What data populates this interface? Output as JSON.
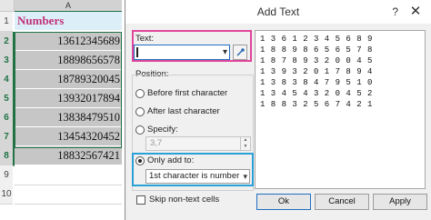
{
  "sheet": {
    "column": "A",
    "rows": [
      "1",
      "2",
      "3",
      "4",
      "5",
      "6",
      "7",
      "8",
      "9",
      "10"
    ],
    "header_cell": "Numbers",
    "values": [
      "13612345689",
      "18898656578",
      "18789320045",
      "13932017894",
      "13838479510",
      "13454320452",
      "18832567421"
    ]
  },
  "dialog": {
    "title": "Add Text",
    "help": "?",
    "close": "✕",
    "text_label": "Text:",
    "text_value": "",
    "position_label": "Position:",
    "options": {
      "before": "Before first character",
      "after": "After last character",
      "specify": "Specify:",
      "only_add": "Only add to:"
    },
    "specify_value": "3,7",
    "only_add_value": "1st character is number",
    "skip_label": "Skip non-text cells",
    "preview_lines": [
      "1 3 6 1 2 3 4 5 6 8 9",
      "1 8 8 9 8 6 5 6 5 7 8",
      "1 8 7 8 9 3 2 0 0 4 5",
      "1 3 9 3 2 0 1 7 8 9 4",
      "1 3 8 3 8 4 7 9 5 1 0",
      "1 3 4 5 4 3 2 0 4 5 2",
      "1 8 8 3 2 5 6 7 4 2 1"
    ],
    "buttons": {
      "ok": "Ok",
      "cancel": "Cancel",
      "apply": "Apply"
    }
  },
  "colors": {
    "text_highlight": "#e0459b",
    "onlyadd_highlight": "#2aa0d6",
    "selection": "#217346",
    "header_text": "#c0307a"
  }
}
